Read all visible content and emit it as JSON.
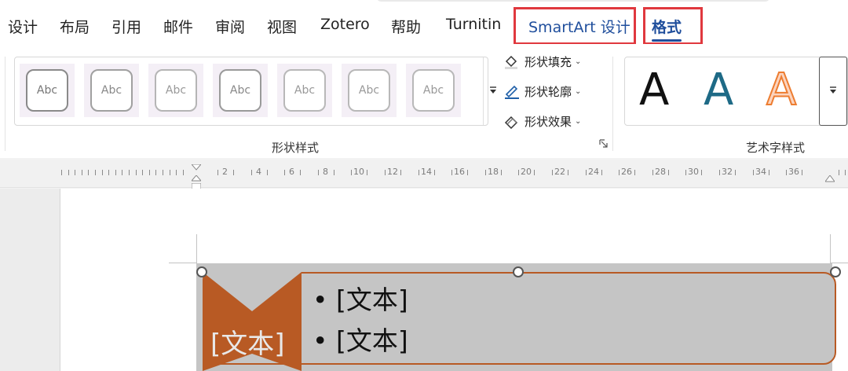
{
  "tabs": [
    {
      "label": "设计"
    },
    {
      "label": "布局"
    },
    {
      "label": "引用"
    },
    {
      "label": "邮件"
    },
    {
      "label": "审阅"
    },
    {
      "label": "视图"
    },
    {
      "label": "Zotero"
    },
    {
      "label": "帮助"
    },
    {
      "label": "Turnitin"
    },
    {
      "label": "SmartArt 设计"
    },
    {
      "label": "格式"
    }
  ],
  "ribbon": {
    "shape_styles": {
      "group_label": "形状样式",
      "thumbnails": [
        "Abc",
        "Abc",
        "Abc",
        "Abc",
        "Abc",
        "Abc",
        "Abc"
      ]
    },
    "commands": {
      "fill": "形状填充",
      "outline": "形状轮廓",
      "effects": "形状效果"
    },
    "wordart": {
      "group_label": "艺术字样式",
      "samples": [
        "A",
        "A",
        "A"
      ]
    }
  },
  "ruler": {
    "labels": [
      "2",
      "4",
      "6",
      "8",
      "10",
      "12",
      "14",
      "16",
      "18",
      "20",
      "22",
      "24",
      "26",
      "28",
      "30",
      "32",
      "34",
      "36"
    ]
  },
  "smartart": {
    "chevron_text": "[文本]",
    "bullets": [
      "• [文本]",
      "• [文本]"
    ]
  },
  "colors": {
    "accent_blue": "#1f4e9c",
    "highlight_red": "#e0383e",
    "chevron_orange": "#b85a24",
    "frame_gray": "#c5c5c5"
  }
}
